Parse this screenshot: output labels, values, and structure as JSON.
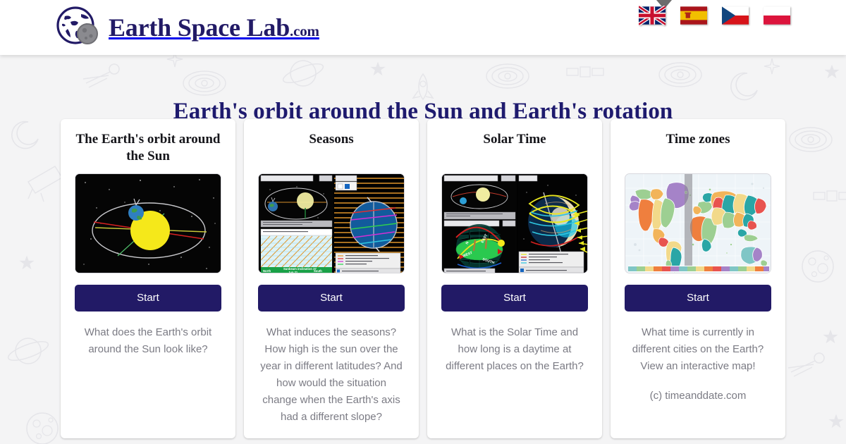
{
  "header": {
    "brand_name": "Earth Space Lab",
    "brand_tld": ".com",
    "logo_icon": "earth-moon-globe-icon",
    "languages": [
      {
        "code": "en",
        "label": "English",
        "icon": "flag-united-kingdom-icon",
        "selected": true
      },
      {
        "code": "es",
        "label": "Espanol",
        "icon": "flag-spain-icon",
        "selected": false
      },
      {
        "code": "cs",
        "label": "Cestina",
        "icon": "flag-czech-republic-icon",
        "selected": false
      },
      {
        "code": "pl",
        "label": "Polski",
        "icon": "flag-poland-icon",
        "selected": false
      }
    ]
  },
  "page": {
    "title": "Earth's orbit around the Sun and Earth's rotation",
    "background": "#f4f4f5",
    "title_color": "#1e1a6e",
    "accent_color": "#221a66",
    "desc_color": "#7b7b84"
  },
  "cards": [
    {
      "title": "The Earth's orbit around the Sun",
      "thumb_icon": "earth-orbit-around-sun-thumbnail",
      "button_label": "Start",
      "description": "What does the Earth's orbit around the Sun look like?",
      "credit": ""
    },
    {
      "title": "Seasons",
      "thumb_icon": "seasons-simulation-thumbnail",
      "button_label": "Start",
      "description": "What induces the seasons? How high is the sun over the year in different latitudes? And how would the situation change when the Earth's axis had a different slope?",
      "credit": ""
    },
    {
      "title": "Solar Time",
      "thumb_icon": "solar-time-simulation-thumbnail",
      "button_label": "Start",
      "description": "What is the Solar Time and how long is a daytime at different places on the Earth?",
      "credit": ""
    },
    {
      "title": "Time zones",
      "thumb_icon": "world-time-zones-map-thumbnail",
      "button_label": "Start",
      "description": "What time is currently in different cities on the Earth? View an interactive map!",
      "credit": "(c) timeanddate.com"
    }
  ]
}
